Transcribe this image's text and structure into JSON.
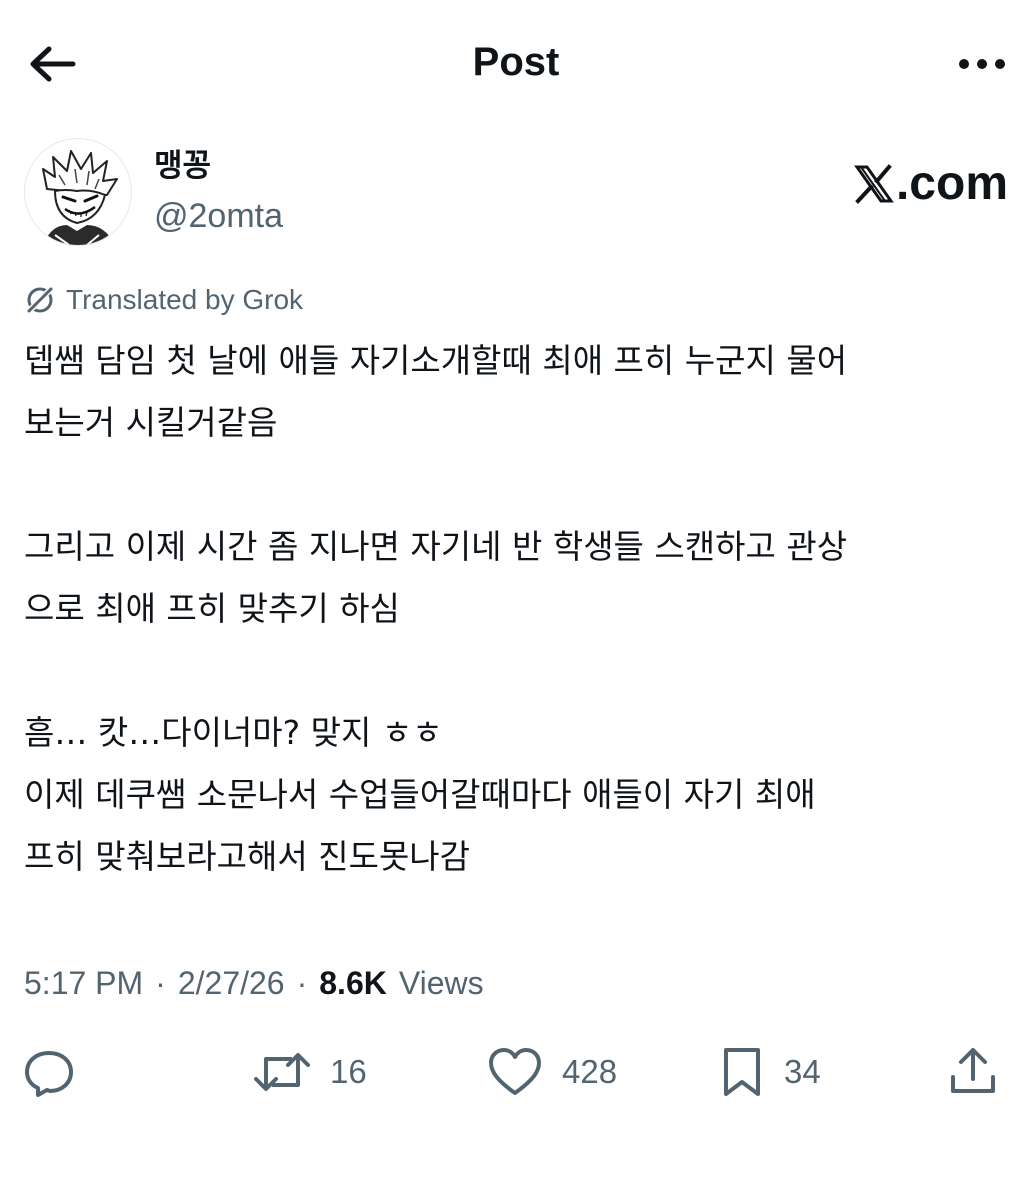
{
  "header": {
    "title": "Post",
    "back_icon": "arrow-left-icon",
    "more_icon": "more-horizontal-icon"
  },
  "author": {
    "display_name": "맹꽁",
    "handle": "@2omta",
    "avatar_icon": "avatar-illustration"
  },
  "brand": {
    "label": ".com",
    "logo_icon": "x-logo-icon"
  },
  "translation": {
    "label": "Translated by Grok",
    "icon": "grok-icon"
  },
  "post": {
    "lines": [
      "뎁쌤 담임 첫 날에 애들 자기소개할때 최애 프히 누군지 물어",
      "보는거 시킬거같음",
      "",
      "그리고 이제 시간 좀 지나면 자기네 반 학생들 스캔하고 관상",
      "으로 최애 프히 맞추기 하심",
      "",
      "흠… 캇…다이너마? 맞지 ㅎㅎ",
      "이제 데쿠쌤 소문나서 수업들어갈때마다 애들이 자기 최애",
      "프히 맞춰보라고해서 진도못나감"
    ]
  },
  "meta": {
    "time": "5:17 PM",
    "separator": "·",
    "date": "2/27/26",
    "views_count": "8.6K",
    "views_label": "Views"
  },
  "actions": {
    "reply": {
      "icon": "reply-icon",
      "count": ""
    },
    "repost": {
      "icon": "repost-icon",
      "count": "16"
    },
    "like": {
      "icon": "heart-icon",
      "count": "428"
    },
    "bookmark": {
      "icon": "bookmark-icon",
      "count": "34"
    },
    "share": {
      "icon": "share-icon",
      "count": ""
    }
  },
  "colors": {
    "text_primary": "#0f1419",
    "text_secondary": "#536471",
    "background": "#ffffff"
  }
}
